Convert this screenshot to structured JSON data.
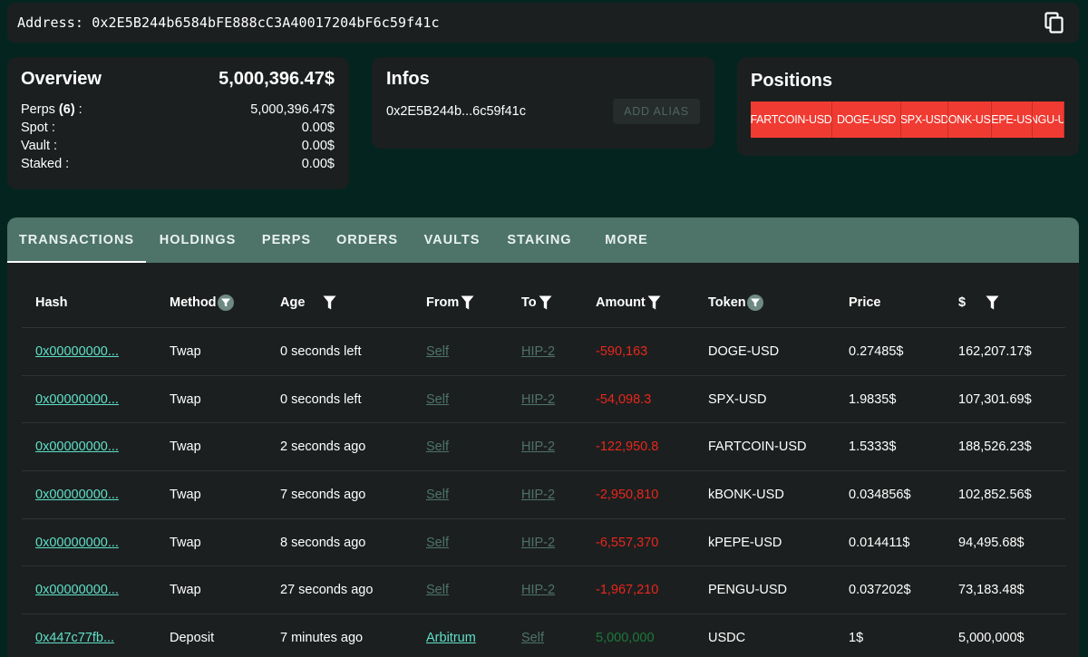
{
  "address_bar": {
    "label": "Address:",
    "address": "0x2E5B244b6584bFE888cC3A40017204bF6c59f41c"
  },
  "overview": {
    "title": "Overview",
    "total": "5,000,396.47$",
    "rows": [
      {
        "label_html_prefix": "Perps ",
        "label_count": "(6)",
        "label_suffix": " :",
        "value": "5,000,396.47$"
      },
      {
        "label": "Spot :",
        "value": "0.00$"
      },
      {
        "label": "Vault :",
        "value": "0.00$"
      },
      {
        "label": "Staked :",
        "value": "0.00$"
      }
    ]
  },
  "infos": {
    "title": "Infos",
    "short_address": "0x2E5B244b...6c59f41c",
    "alias_button": "ADD ALIAS"
  },
  "positions": {
    "title": "Positions",
    "badges": [
      "FARTCOIN-USD",
      "DOGE-USD",
      "SPX-USD",
      "BONK-USD",
      "PEPE-USD",
      "PENGU-USD"
    ],
    "badge_color": "#f03b32"
  },
  "tabs": [
    "TRANSACTIONS",
    "HOLDINGS",
    "PERPS",
    "ORDERS",
    "VAULTS",
    "STAKING",
    "MORE"
  ],
  "table": {
    "headers": [
      "Hash",
      "Method",
      "Age",
      "From",
      "To",
      "Amount",
      "Token",
      "Price",
      "$"
    ],
    "rows": [
      {
        "hash": "0x00000000...",
        "method": "Twap",
        "age": "0 seconds left",
        "from": "Self",
        "to": "HIP-2",
        "amount": "-590,163",
        "amount_sign": "neg",
        "token": "DOGE-USD",
        "price": "0.27485$",
        "usd": "162,207.17$"
      },
      {
        "hash": "0x00000000...",
        "method": "Twap",
        "age": "0 seconds left",
        "from": "Self",
        "to": "HIP-2",
        "amount": "-54,098.3",
        "amount_sign": "neg",
        "token": "SPX-USD",
        "price": "1.9835$",
        "usd": "107,301.69$"
      },
      {
        "hash": "0x00000000...",
        "method": "Twap",
        "age": "2 seconds ago",
        "from": "Self",
        "to": "HIP-2",
        "amount": "-122,950.8",
        "amount_sign": "neg",
        "token": "FARTCOIN-USD",
        "price": "1.5333$",
        "usd": "188,526.23$"
      },
      {
        "hash": "0x00000000...",
        "method": "Twap",
        "age": "7 seconds ago",
        "from": "Self",
        "to": "HIP-2",
        "amount": "-2,950,810",
        "amount_sign": "neg",
        "token": "kBONK-USD",
        "price": "0.034856$",
        "usd": "102,852.56$"
      },
      {
        "hash": "0x00000000...",
        "method": "Twap",
        "age": "8 seconds ago",
        "from": "Self",
        "to": "HIP-2",
        "amount": "-6,557,370",
        "amount_sign": "neg",
        "token": "kPEPE-USD",
        "price": "0.014411$",
        "usd": "94,495.68$"
      },
      {
        "hash": "0x00000000...",
        "method": "Twap",
        "age": "27 seconds ago",
        "from": "Self",
        "to": "HIP-2",
        "amount": "-1,967,210",
        "amount_sign": "neg",
        "token": "PENGU-USD",
        "price": "0.037202$",
        "usd": "73,183.48$"
      },
      {
        "hash": "0x447c77fb...",
        "method": "Deposit",
        "age": "7 minutes ago",
        "from": "Arbitrum",
        "to": "Self",
        "amount": "5,000,000",
        "amount_sign": "pos",
        "token": "USDC",
        "price": "1$",
        "usd": "5,000,000$"
      }
    ]
  },
  "colors": {
    "background": "#04251f",
    "card": "#1b1f1f",
    "tab_bar": "#4e7369",
    "link": "#5ee0c8",
    "negative": "#e8271d",
    "positive": "#1b7a3c"
  }
}
